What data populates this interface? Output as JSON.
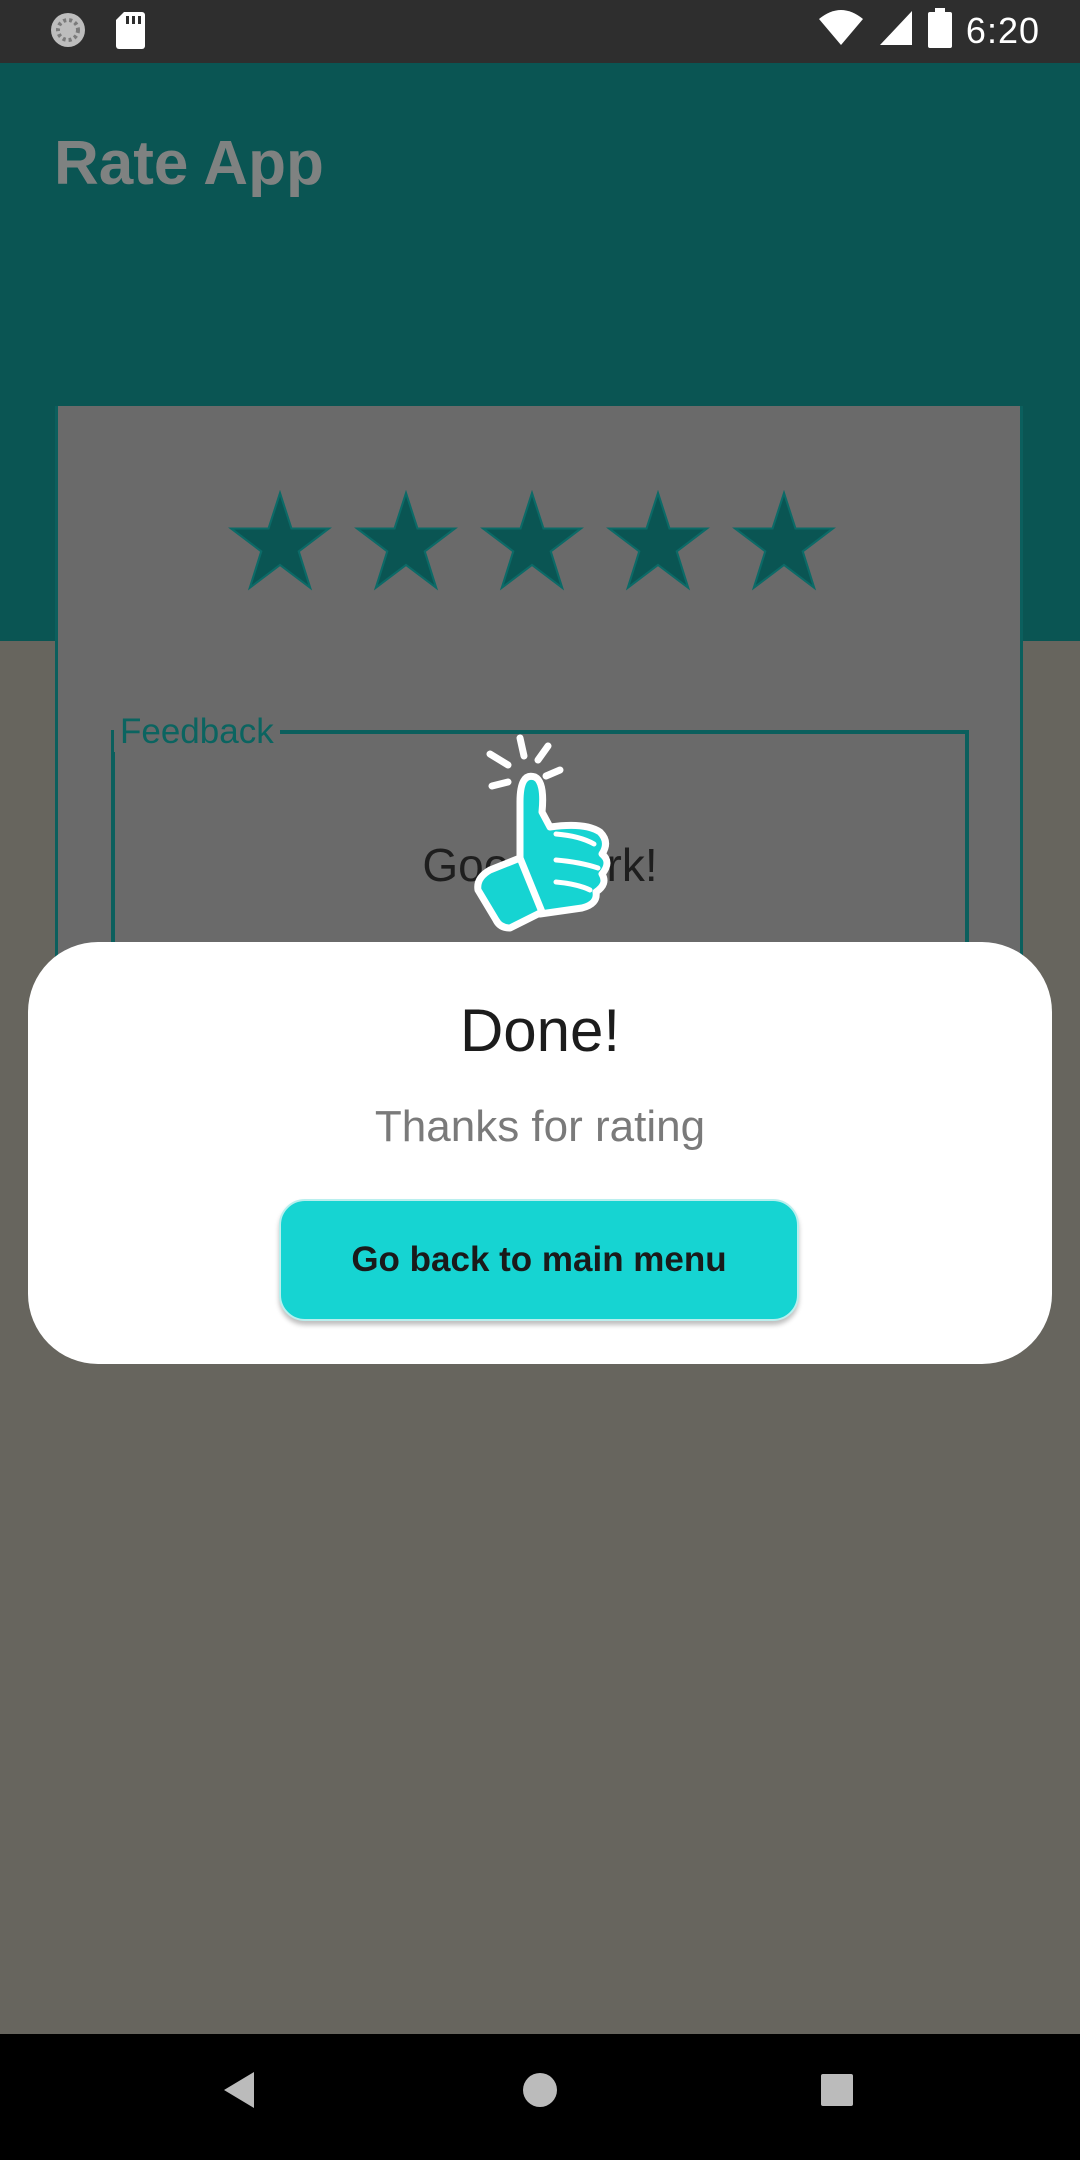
{
  "status_bar": {
    "time": "6:20",
    "icons": [
      "sync-icon",
      "sd-card-icon",
      "wifi-icon",
      "cell-signal-icon",
      "battery-icon"
    ]
  },
  "app_bar": {
    "title": "Rate App"
  },
  "rating": {
    "stars_filled": 5,
    "stars_total": 5,
    "star_color": "#0a5553"
  },
  "feedback": {
    "label": "Feedback",
    "value": "Good work!"
  },
  "dialog": {
    "icon": "thumbs-up-icon",
    "title": "Done!",
    "subtitle": "Thanks for rating",
    "button_label": "Go back to main menu",
    "button_color": "#16d4d2"
  },
  "nav_bar": {
    "buttons": [
      "back-icon",
      "home-icon",
      "recents-icon"
    ]
  }
}
